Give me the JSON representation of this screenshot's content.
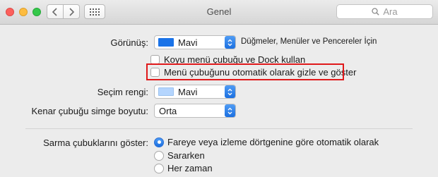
{
  "window": {
    "title": "Genel",
    "search_placeholder": "Ara",
    "traffic_lights": {
      "close": "#fc605c",
      "minimize": "#fdbc40",
      "zoom": "#34c84a"
    }
  },
  "appearance": {
    "label": "Görünüş:",
    "value": "Mavi",
    "swatch_color": "#1a73e8",
    "note": "Düğmeler, Menüler ve Pencereler İçin"
  },
  "options": {
    "dark_menu_label": "Koyu menü çubuğu ve Dock kullan",
    "dark_menu_checked": false,
    "auto_hide_menu_label": "Menü çubuğunu otomatik olarak gizle ve göster",
    "auto_hide_menu_checked": false
  },
  "highlight": {
    "label": "Seçim rengi:",
    "value": "Mavi",
    "swatch_color": "#b4d5fe"
  },
  "sidebar_icon_size": {
    "label": "Kenar çubuğu simge boyutu:",
    "value": "Orta"
  },
  "scroll_bars": {
    "label": "Sarma çubuklarını göster:",
    "options": [
      {
        "label": "Fareye veya izleme dörtgenine göre otomatik olarak",
        "selected": true
      },
      {
        "label": "Sararken",
        "selected": false
      },
      {
        "label": "Her zaman",
        "selected": false
      }
    ]
  },
  "accent_color": "#1b6fe0",
  "callout_color": "#e0191b"
}
